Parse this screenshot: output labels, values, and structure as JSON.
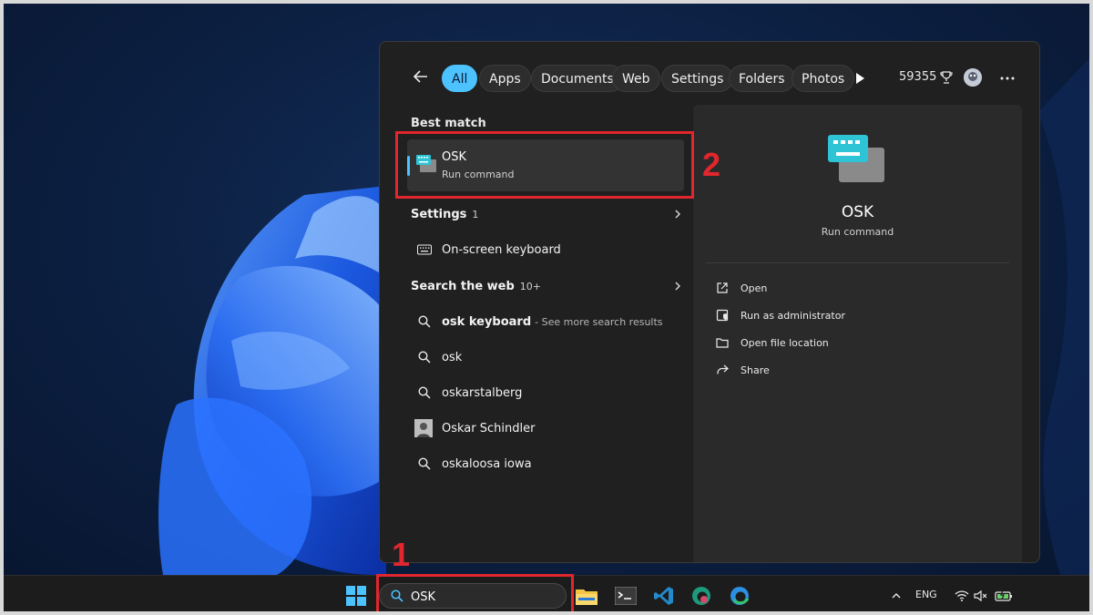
{
  "search_panel": {
    "filters": [
      {
        "label": "All",
        "active": true
      },
      {
        "label": "Apps",
        "active": false
      },
      {
        "label": "Documents",
        "active": false
      },
      {
        "label": "Web",
        "active": false
      },
      {
        "label": "Settings",
        "active": false
      },
      {
        "label": "Folders",
        "active": false
      },
      {
        "label": "Photos",
        "active": false
      }
    ],
    "points": "59355",
    "best_match": {
      "section_title": "Best match",
      "name": "OSK",
      "type": "Run command"
    },
    "settings": {
      "section_title": "Settings",
      "count": "1",
      "items": [
        {
          "label": "On-screen keyboard",
          "icon": "keyboard-icon"
        }
      ]
    },
    "web": {
      "section_title": "Search the web",
      "count": "10+",
      "items": [
        {
          "label": "osk keyboard",
          "suffix": "- See more search results"
        },
        {
          "label": "osk"
        },
        {
          "label": "oskarstalberg"
        },
        {
          "label": "Oskar Schindler",
          "icon": "person-photo"
        },
        {
          "label": "oskaloosa iowa"
        }
      ]
    },
    "preview": {
      "name": "OSK",
      "type": "Run command",
      "actions": [
        {
          "label": "Open",
          "icon": "open-external-icon"
        },
        {
          "label": "Run as administrator",
          "icon": "admin-shield-icon"
        },
        {
          "label": "Open file location",
          "icon": "folder-icon"
        },
        {
          "label": "Share",
          "icon": "share-icon"
        }
      ]
    }
  },
  "taskbar": {
    "search_value": "OSK",
    "tray_language": "ENG"
  },
  "annotations": [
    {
      "number": "1"
    },
    {
      "number": "2"
    }
  ],
  "colors": {
    "accent": "#4cc2ff",
    "annotation": "#e1262d",
    "panel": "#202020"
  }
}
